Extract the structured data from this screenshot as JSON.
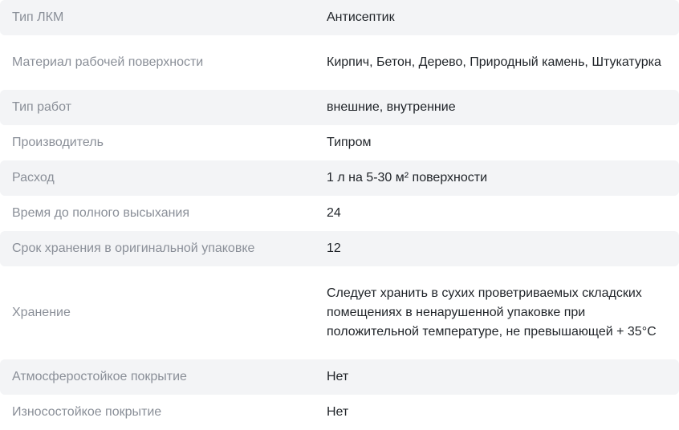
{
  "specs": [
    {
      "label": "Тип ЛКМ",
      "value": "Антисептик"
    },
    {
      "label": "Материал рабочей поверхности",
      "value": "Кирпич, Бетон, Дерево, Природный камень, Штукатурка"
    },
    {
      "label": "Тип работ",
      "value": "внешние, внутренние"
    },
    {
      "label": "Производитель",
      "value": "Типром"
    },
    {
      "label": "Расход",
      "value": "1 л на 5-30 м² поверхности"
    },
    {
      "label": "Время до полного высыхания",
      "value": "24"
    },
    {
      "label": "Срок хранения в оригинальной упаковке",
      "value": "12"
    },
    {
      "label": "Хранение",
      "value": "Следует хранить в сухих проветриваемых складских помещениях в ненарушенной упаковке при положительной температуре, не превышающей + 35°С"
    },
    {
      "label": "Атмосферостойкое покрытие",
      "value": "Нет"
    },
    {
      "label": "Износостойкое покрытие",
      "value": "Нет"
    }
  ]
}
